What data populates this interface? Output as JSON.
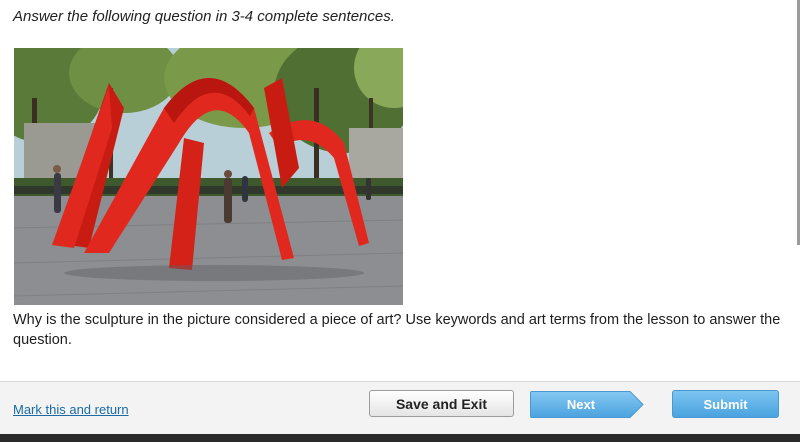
{
  "instructions": "Answer the following question in 3-4 complete sentences.",
  "image": {
    "subject": "red-arch-sculpture-photo"
  },
  "question": "Why is the sculpture in the picture considered a piece of art? Use keywords and art terms from the lesson to answer the question.",
  "footer": {
    "mark_link": "Mark this and return",
    "save_exit_label": "Save and Exit",
    "next_label": "Next",
    "submit_label": "Submit"
  },
  "colors": {
    "sculpture_red": "#e0281e",
    "link_blue": "#1b6aa5",
    "button_blue": "#5db1e8",
    "footer_bg": "#f3f3f3"
  }
}
